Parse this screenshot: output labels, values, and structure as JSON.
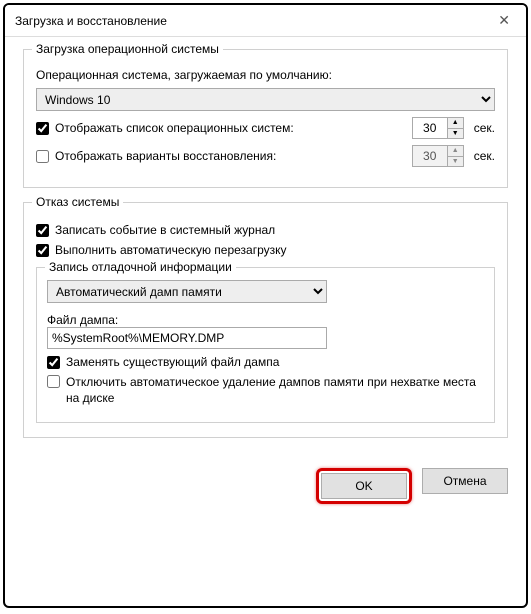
{
  "window": {
    "title": "Загрузка и восстановление"
  },
  "startup": {
    "legend": "Загрузка операционной системы",
    "os_label": "Операционная система, загружаемая по умолчанию:",
    "os_value": "Windows 10",
    "show_os_list": "Отображать список операционных систем:",
    "show_os_seconds": "30",
    "show_recovery": "Отображать варианты восстановления:",
    "show_recovery_seconds": "30",
    "sec": "сек."
  },
  "failure": {
    "legend": "Отказ системы",
    "log_event": "Записать событие в системный журнал",
    "auto_restart": "Выполнить автоматическую перезагрузку",
    "debug": {
      "legend": "Запись отладочной информации",
      "dump_type": "Автоматический дамп памяти",
      "file_label": "Файл дампа:",
      "file_value": "%SystemRoot%\\MEMORY.DMP",
      "overwrite": "Заменять существующий файл дампа",
      "disable_auto_delete": "Отключить автоматическое удаление дампов памяти при нехватке места на диске"
    }
  },
  "buttons": {
    "ok": "OK",
    "cancel": "Отмена"
  }
}
